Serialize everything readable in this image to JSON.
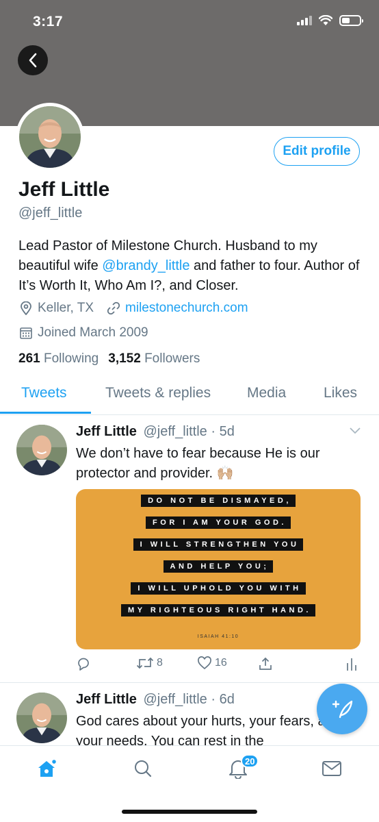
{
  "status_bar": {
    "time": "3:17"
  },
  "profile": {
    "name": "Jeff Little",
    "handle": "@jeff_little",
    "edit_label": "Edit profile",
    "bio_part1": "Lead Pastor of Milestone Church. Husband to my beautiful wife ",
    "bio_mention": "@brandy_little",
    "bio_part2": " and father to four. Author of It’s Worth It, Who Am I?, and Closer.",
    "location": "Keller, TX",
    "website": "milestonechurch.com",
    "joined": "Joined March 2009",
    "following_count": "261",
    "following_label": "Following",
    "followers_count": "3,152",
    "followers_label": "Followers"
  },
  "tabs": [
    {
      "label": "Tweets"
    },
    {
      "label": "Tweets & replies"
    },
    {
      "label": "Media"
    },
    {
      "label": "Likes"
    }
  ],
  "tweets": [
    {
      "name": "Jeff Little",
      "handle": "@jeff_little",
      "time": "5d",
      "text": "We don’t have to fear because He is our protector and provider. 🙌🏼",
      "image_lines": [
        "DO NOT BE DISMAYED,",
        "FOR I AM YOUR GOD.",
        "I WILL STRENGTHEN YOU",
        "AND HELP YOU;",
        "I WILL UPHOLD YOU WITH",
        "MY RIGHTEOUS RIGHT HAND."
      ],
      "image_ref": "ISAIAH 41:10",
      "retweets": "8",
      "likes": "16"
    },
    {
      "name": "Jeff Little",
      "handle": "@jeff_little",
      "time": "6d",
      "text": "God cares about your hurts, your fears, and your needs. You can rest in the"
    }
  ],
  "nav": {
    "notification_count": "20"
  },
  "colors": {
    "accent": "#1da1f2",
    "banner": "#6d6b6a",
    "verse_card": "#e7a33d"
  },
  "icons": [
    "back-icon",
    "location-icon",
    "link-icon",
    "calendar-icon",
    "chevron-down-icon",
    "reply-icon",
    "retweet-icon",
    "like-icon",
    "share-icon",
    "analytics-icon",
    "compose-icon",
    "home-icon",
    "search-icon",
    "notifications-icon",
    "messages-icon"
  ]
}
